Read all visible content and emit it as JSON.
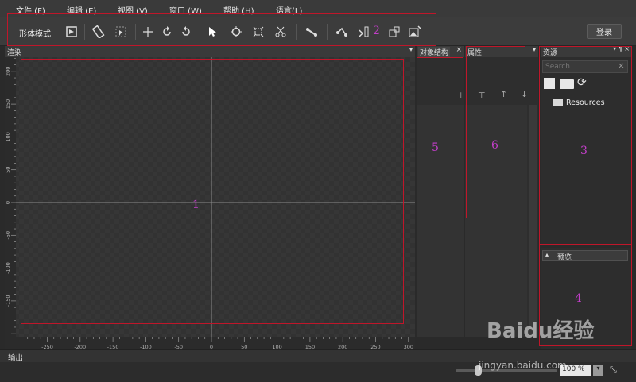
{
  "menu": [
    "文件 (F)",
    "编辑 (E)",
    "视图 (V)",
    "窗口 (W)",
    "帮助 (H)",
    "语言(L)"
  ],
  "toolbar": {
    "mode_label": "形体模式",
    "login_label": "登录"
  },
  "render_panel": {
    "title": "渲染"
  },
  "object_panel": {
    "title": "对象结构"
  },
  "props_panel": {
    "title": "属性"
  },
  "resource_panel": {
    "title": "资源",
    "search_placeholder": "Search",
    "items": [
      {
        "label": "Resources",
        "icon": "folder-icon"
      }
    ]
  },
  "preview_panel": {
    "title": "预览"
  },
  "output_panel": {
    "title": "输出"
  },
  "status": {
    "zoom": "100 %",
    "zoom_slider_fraction": 0.22
  },
  "annotations": [
    "1",
    "2",
    "3",
    "4",
    "5",
    "6"
  ],
  "watermark": {
    "site": "jingyan.baidu.com",
    "brand": "Baidu经验"
  },
  "colors": {
    "annotation_box": "#c0162a",
    "annotation_text": "#c23ec8",
    "panel_bg": "#2f2f2f",
    "canvas_bg": "#353535"
  },
  "chart_data": {
    "type": "ruler",
    "x_ticks": [
      "-250",
      "-200",
      "-150",
      "-100",
      "-50",
      "0",
      "50",
      "100",
      "150",
      "200",
      "250",
      "300"
    ],
    "y_ticks": [
      "200",
      "150",
      "100",
      "50",
      "0",
      "-50",
      "-100",
      "-150"
    ]
  }
}
